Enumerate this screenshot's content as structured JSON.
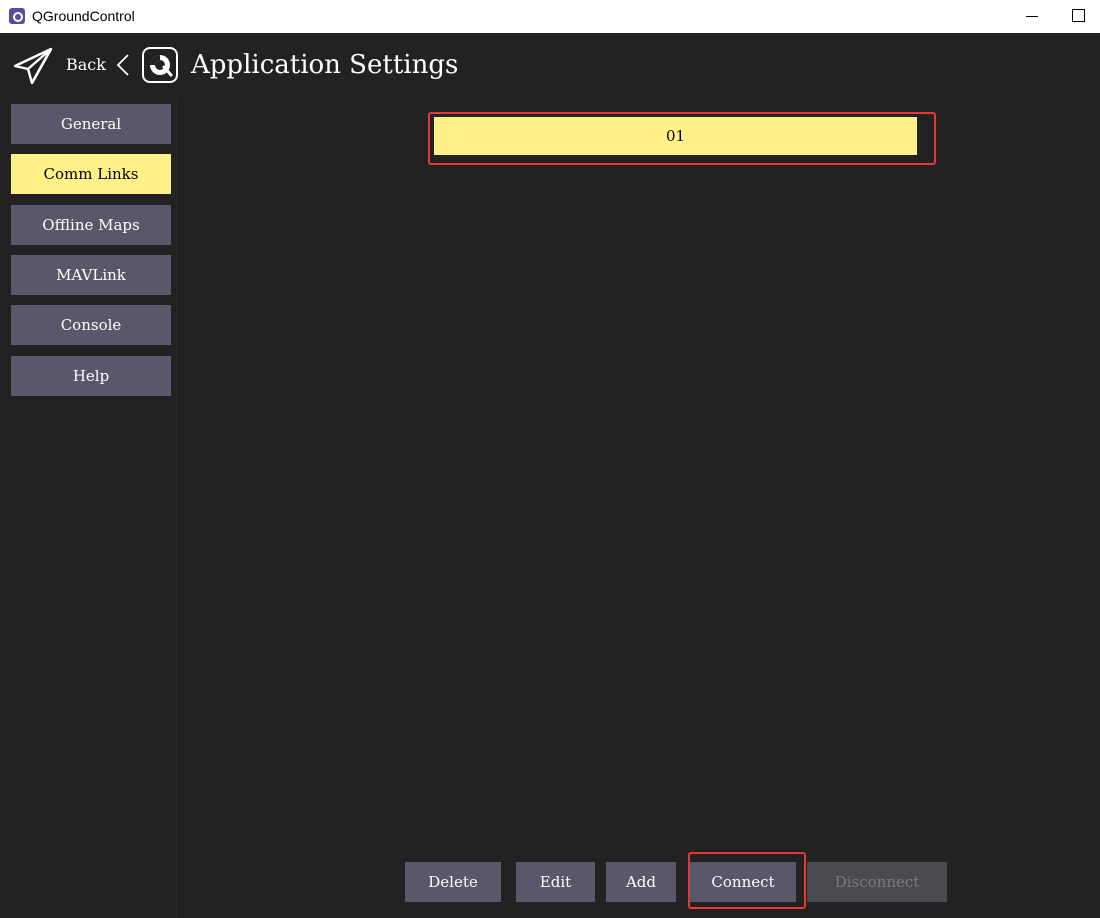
{
  "window": {
    "title": "QGroundControl",
    "app_icon": "qgc-app-icon",
    "controls": [
      "minimize-icon",
      "maximize-icon"
    ]
  },
  "header": {
    "back_icon": "paper-plane-icon",
    "back_label": "Back",
    "chevron": "<",
    "logo_icon": "qgc-logo-icon",
    "title": "Application Settings"
  },
  "sidebar": {
    "items": [
      {
        "label": "General",
        "active": false
      },
      {
        "label": "Comm Links",
        "active": true
      },
      {
        "label": "Offline Maps",
        "active": false
      },
      {
        "label": "MAVLink",
        "active": false
      },
      {
        "label": "Console",
        "active": false
      },
      {
        "label": "Help",
        "active": false
      }
    ]
  },
  "links": {
    "items": [
      {
        "name": "01",
        "selected": true
      }
    ]
  },
  "actions": {
    "delete": "Delete",
    "edit": "Edit",
    "add": "Add",
    "connect": "Connect",
    "disconnect": "Disconnect"
  },
  "colors": {
    "background": "#222222",
    "button": "#58586a",
    "highlight": "#fff187",
    "annotation": "#e53935"
  }
}
